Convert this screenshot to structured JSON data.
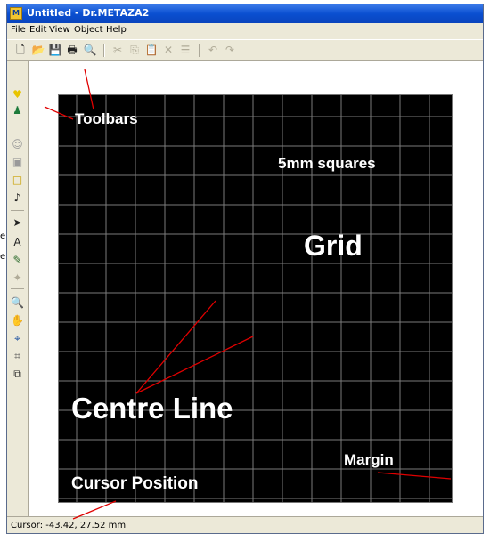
{
  "window": {
    "title": "Untitled - Dr.METAZA2",
    "app_icon": "metaza-app-icon"
  },
  "menu": [
    "File",
    "Edit",
    "View",
    "Object",
    "Help"
  ],
  "toolbar": {
    "buttons": [
      {
        "icon": "new-file-icon",
        "glyph": "🗋",
        "enabled": true
      },
      {
        "icon": "open-folder-icon",
        "glyph": "📂",
        "enabled": true
      },
      {
        "icon": "save-icon",
        "glyph": "💾",
        "enabled": true
      },
      {
        "icon": "print-icon",
        "glyph": "🖶",
        "enabled": true
      },
      {
        "icon": "print-preview-icon",
        "glyph": "🔍",
        "enabled": true
      },
      {
        "icon": "cut-icon",
        "glyph": "✂",
        "enabled": false
      },
      {
        "icon": "copy-icon",
        "glyph": "⎘",
        "enabled": false
      },
      {
        "icon": "paste-icon",
        "glyph": "📋",
        "enabled": false
      },
      {
        "icon": "delete-icon",
        "glyph": "✕",
        "enabled": false
      },
      {
        "icon": "properties-icon",
        "glyph": "☰",
        "enabled": false
      },
      {
        "icon": "undo-icon",
        "glyph": "↶",
        "enabled": false
      },
      {
        "icon": "redo-icon",
        "glyph": "↷",
        "enabled": false
      }
    ]
  },
  "left_toolbar": [
    {
      "icon": "heart-icon",
      "glyph": "♥",
      "color": "#e8c400"
    },
    {
      "icon": "users-icon",
      "glyph": "♟",
      "color": "#1d7a3a"
    },
    {
      "icon": "person-icon",
      "glyph": "☺",
      "color": "#9a9a9a"
    },
    {
      "icon": "image-icon",
      "glyph": "▣",
      "color": "#9a9a9a"
    },
    {
      "icon": "rectangle-icon",
      "glyph": "□",
      "color": "#c9a000"
    },
    {
      "icon": "music-note-icon",
      "glyph": "♪",
      "color": "#222222"
    },
    {
      "icon": "select-arrow-icon",
      "glyph": "➤",
      "color": "#222222"
    },
    {
      "icon": "text-tool-icon",
      "glyph": "A",
      "color": "#222222"
    },
    {
      "icon": "pen-tool-icon",
      "glyph": "✎",
      "color": "#2a6a2a"
    },
    {
      "icon": "node-tool-icon",
      "glyph": "✦",
      "color": "#b0ab98"
    },
    {
      "icon": "zoom-icon",
      "glyph": "🔍",
      "color": "#1a4fa0"
    },
    {
      "icon": "hand-pan-icon",
      "glyph": "✋",
      "color": "#d4a000"
    },
    {
      "icon": "fit-page-icon",
      "glyph": "⌖",
      "color": "#1a4fa0"
    },
    {
      "icon": "grid-snap-icon",
      "glyph": "⌗",
      "color": "#555555"
    },
    {
      "icon": "layers-icon",
      "glyph": "⧉",
      "color": "#222222"
    }
  ],
  "annotations": {
    "toolbars": "Toolbars",
    "squares": "5mm squares",
    "grid": "Grid",
    "centre_line": "Centre Line",
    "margin": "Margin",
    "cursor_position": "Cursor Position"
  },
  "status": {
    "cursor": "Cursor: -43.42, 27.52 mm"
  },
  "edge_fragments": [
    "e",
    "e"
  ],
  "colors": {
    "annotation_line": "#e00000",
    "grid_background": "#000000",
    "grid_line": "#7a7a7a",
    "title_bar": "#0a4fd1"
  }
}
